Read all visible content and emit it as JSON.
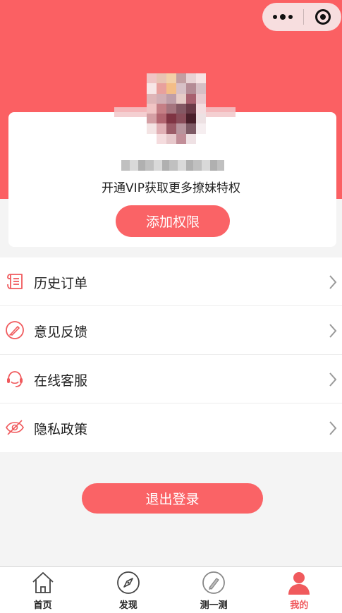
{
  "colors": {
    "brand": "#fb6063",
    "button": "#fa6366",
    "active_tab": "#f05a5d",
    "background": "#f4f4f4"
  },
  "capsule": {
    "more_icon": "more-dots-icon",
    "close_icon": "target-close-icon"
  },
  "profile": {
    "avatar": "avatar-image",
    "vip_prompt": "开通VIP获取更多撩妹特权",
    "add_permission_label": "添加权限"
  },
  "menu": {
    "items": [
      {
        "label": "历史订单",
        "icon": "order-list-icon"
      },
      {
        "label": "意见反馈",
        "icon": "feedback-pen-icon"
      },
      {
        "label": "在线客服",
        "icon": "headset-icon"
      },
      {
        "label": "隐私政策",
        "icon": "hidden-eye-icon"
      }
    ]
  },
  "logout_label": "退出登录",
  "tabbar": {
    "active_index": 3,
    "tabs": [
      {
        "label": "首页",
        "icon": "home-icon"
      },
      {
        "label": "发现",
        "icon": "compass-icon"
      },
      {
        "label": "测一测",
        "icon": "pencil-circle-icon"
      },
      {
        "label": "我的",
        "icon": "person-icon"
      }
    ]
  }
}
